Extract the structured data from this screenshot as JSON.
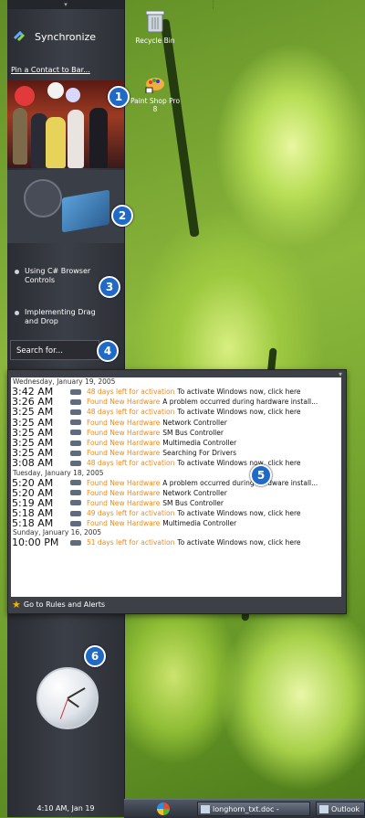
{
  "sidebar": {
    "sync_label": "Synchronize",
    "pin_label": "Pin a Contact to Bar...",
    "links": [
      "Using C# Browser Controls",
      "Implementing Drag and Drop"
    ],
    "search_placeholder": "Search for...",
    "clock_label": "4:10 AM, Jan 19"
  },
  "desktop": {
    "icons": [
      {
        "label": "Recycle Bin",
        "icon": "recycle-bin-icon"
      },
      {
        "label": "Paint Shop Pro 8",
        "icon": "paint-shop-pro-icon"
      }
    ]
  },
  "badges": [
    "1",
    "2",
    "3",
    "4",
    "5",
    "6"
  ],
  "notifications": {
    "groups": [
      {
        "date": "Wednesday, January 19, 2005",
        "items": [
          {
            "time": "3:42 AM",
            "source": "48 days left for activation",
            "message": "To activate Windows now, click here"
          },
          {
            "time": "3:26 AM",
            "source": "Found New Hardware",
            "message": "A problem occurred during hardware install..."
          },
          {
            "time": "3:25 AM",
            "source": "48 days left for activation",
            "message": "To activate Windows now, click here"
          },
          {
            "time": "3:25 AM",
            "source": "Found New Hardware",
            "message": "Network Controller"
          },
          {
            "time": "3:25 AM",
            "source": "Found New Hardware",
            "message": "SM Bus Controller"
          },
          {
            "time": "3:25 AM",
            "source": "Found New Hardware",
            "message": "Multimedia Controller"
          },
          {
            "time": "3:25 AM",
            "source": "Found New Hardware",
            "message": "Searching For Drivers"
          },
          {
            "time": "3:08 AM",
            "source": "48 days left for activation",
            "message": "To activate Windows now, click here"
          }
        ]
      },
      {
        "date": "Tuesday, January 18, 2005",
        "items": [
          {
            "time": "5:20 AM",
            "source": "Found New Hardware",
            "message": "A problem occurred during hardware install..."
          },
          {
            "time": "5:20 AM",
            "source": "Found New Hardware",
            "message": "Network Controller"
          },
          {
            "time": "5:19 AM",
            "source": "Found New Hardware",
            "message": "SM Bus Controller"
          },
          {
            "time": "5:18 AM",
            "source": "49 days left for activation",
            "message": "To activate Windows now, click here"
          },
          {
            "time": "5:18 AM",
            "source": "Found New Hardware",
            "message": "Multimedia Controller"
          }
        ]
      },
      {
        "date": "Sunday, January 16, 2005",
        "items": [
          {
            "time": "10:00 PM",
            "source": "51 days left for activation",
            "message": "To activate Windows now, click here"
          }
        ]
      }
    ],
    "footer_label": "Go to Rules and Alerts"
  },
  "taskbar": {
    "buttons": [
      {
        "label": "longhorn_txt.doc -",
        "icon": "word-doc-icon"
      },
      {
        "label": "Outlook",
        "icon": "outlook-icon"
      }
    ]
  },
  "colors": {
    "accent_orange": "#f08a1a",
    "badge_blue": "#2069c5",
    "sidebar_bg": "#3b3f47"
  }
}
